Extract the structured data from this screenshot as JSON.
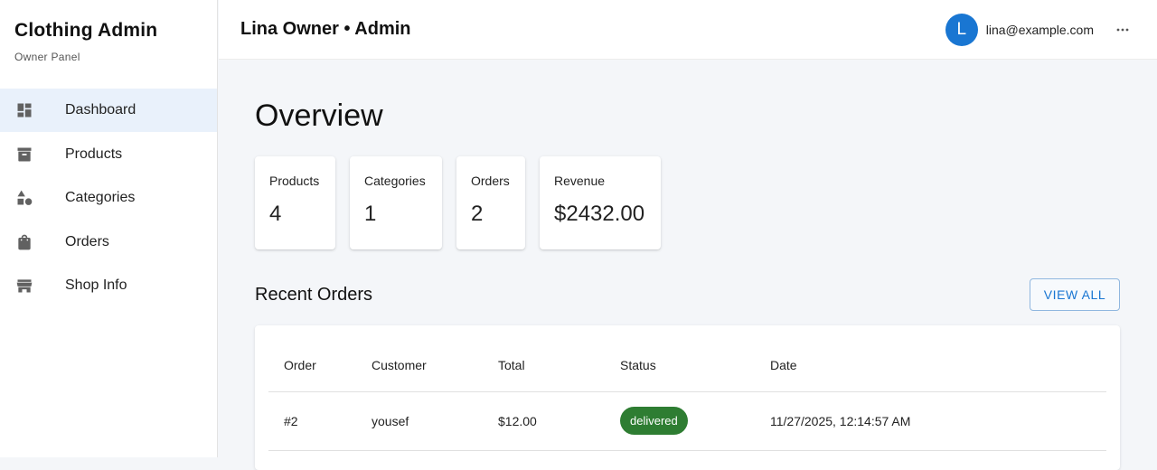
{
  "brand": {
    "title": "Clothing Admin",
    "subtitle": "Owner Panel"
  },
  "sidebar": {
    "items": [
      {
        "label": "Dashboard",
        "icon": "dashboard-icon",
        "active": true
      },
      {
        "label": "Products",
        "icon": "archive-icon",
        "active": false
      },
      {
        "label": "Categories",
        "icon": "category-shapes-icon",
        "active": false
      },
      {
        "label": "Orders",
        "icon": "shopping-bag-icon",
        "active": false
      },
      {
        "label": "Shop Info",
        "icon": "storefront-icon",
        "active": false
      }
    ]
  },
  "header": {
    "title": "Lina Owner • Admin",
    "avatar_initial": "L",
    "email": "lina@example.com",
    "more_icon": "more-horizontal-icon"
  },
  "main": {
    "title": "Overview",
    "stats": [
      {
        "label": "Products",
        "value": "4"
      },
      {
        "label": "Categories",
        "value": "1"
      },
      {
        "label": "Orders",
        "value": "2"
      },
      {
        "label": "Revenue",
        "value": "$2432.00"
      }
    ],
    "recent_orders": {
      "title": "Recent Orders",
      "view_all_label": "VIEW ALL",
      "columns": [
        "Order",
        "Customer",
        "Total",
        "Status",
        "Date"
      ],
      "rows": [
        {
          "order": "#2",
          "customer": "yousef",
          "total": "$12.00",
          "status": "delivered",
          "date": "11/27/2025, 12:14:57 AM"
        }
      ]
    }
  },
  "colors": {
    "accent": "#1976d2",
    "status_delivered": "#2e7d32",
    "active_nav_bg": "#e9f1fb"
  }
}
